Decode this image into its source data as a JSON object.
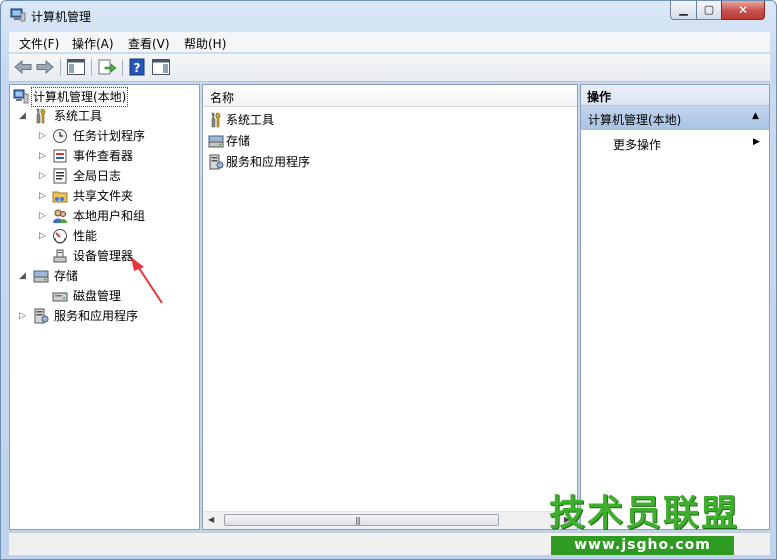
{
  "window": {
    "title": "计算机管理",
    "controls": {
      "minimize": "▁",
      "maximize": "▢",
      "close": "✕"
    }
  },
  "menu": [
    "文件(F)",
    "操作(A)",
    "查看(V)",
    "帮助(H)"
  ],
  "toolbar": {
    "icons": [
      "back-icon",
      "forward-icon",
      "show-hide-console-tree-icon",
      "export-list-icon",
      "help-icon",
      "show-hide-action-pane-icon"
    ]
  },
  "tree": {
    "root": "计算机管理(本地)",
    "system_tools": "系统工具",
    "task_scheduler": "任务计划程序",
    "event_viewer": "事件查看器",
    "global_log": "全局日志",
    "shared_folders": "共享文件夹",
    "local_users": "本地用户和组",
    "performance": "性能",
    "device_manager": "设备管理器",
    "storage": "存储",
    "disk_management": "磁盘管理",
    "services_apps": "服务和应用程序"
  },
  "list": {
    "column_name": "名称",
    "items": [
      "系统工具",
      "存储",
      "服务和应用程序"
    ]
  },
  "actions": {
    "header": "操作",
    "group": "计算机管理(本地)",
    "more": "更多操作"
  },
  "watermark": {
    "cn": "技术员联盟",
    "url": "www.jsgho.com"
  },
  "colors": {
    "selection_bar": "#a9c2e4",
    "window_frame": "#c9daf0",
    "arrow": "#e8343a",
    "watermark_green": "#3fae2e"
  }
}
